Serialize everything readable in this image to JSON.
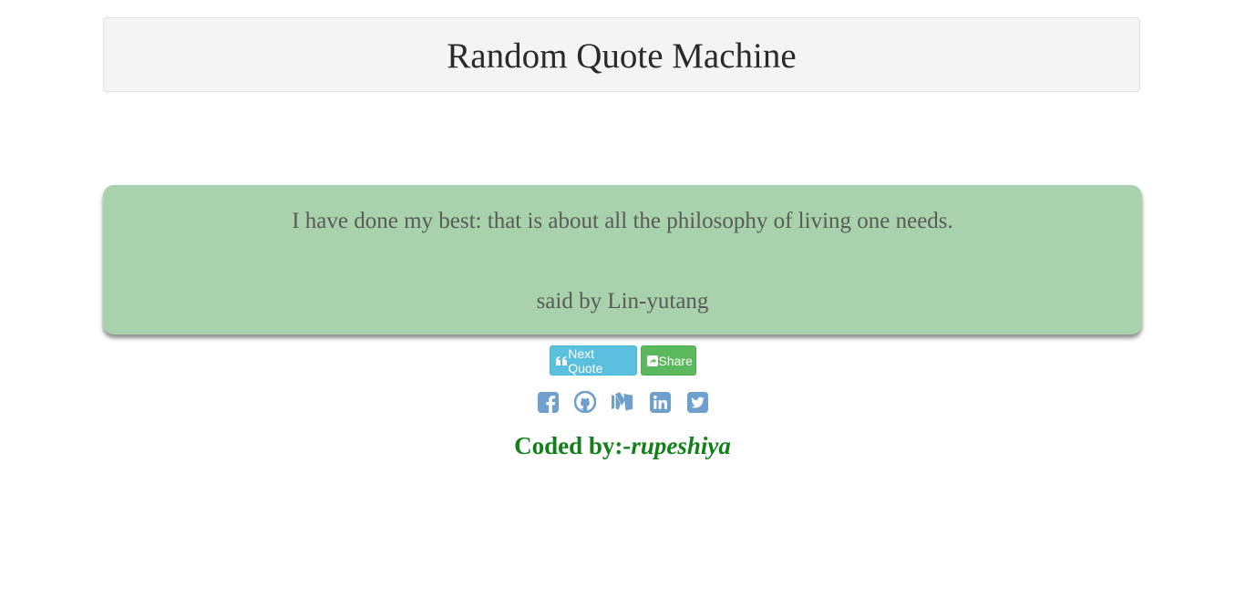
{
  "header": {
    "title": "Random Quote Machine"
  },
  "quote": {
    "text": "I have done my best: that is about all the philosophy of living one needs.",
    "author_line": "said by Lin-yutang"
  },
  "buttons": {
    "next_label": "Next Quote",
    "share_label": "Share",
    "next_icon": "quote-left-icon",
    "share_icon": "share-square-icon"
  },
  "social": [
    {
      "name": "facebook-icon"
    },
    {
      "name": "github-icon"
    },
    {
      "name": "medium-icon"
    },
    {
      "name": "linkedin-icon"
    },
    {
      "name": "twitter-icon"
    }
  ],
  "footer": {
    "prefix": "Coded by:",
    "author": "-rupeshiya"
  },
  "colors": {
    "header_bg": "#f4f4f4",
    "quote_bg": "#a8d2ab",
    "quote_text": "#5a5a5a",
    "next_button": "#5bc0de",
    "share_button": "#5cb85c",
    "social_icon": "#6e9fcd",
    "credit_text": "#118018"
  }
}
